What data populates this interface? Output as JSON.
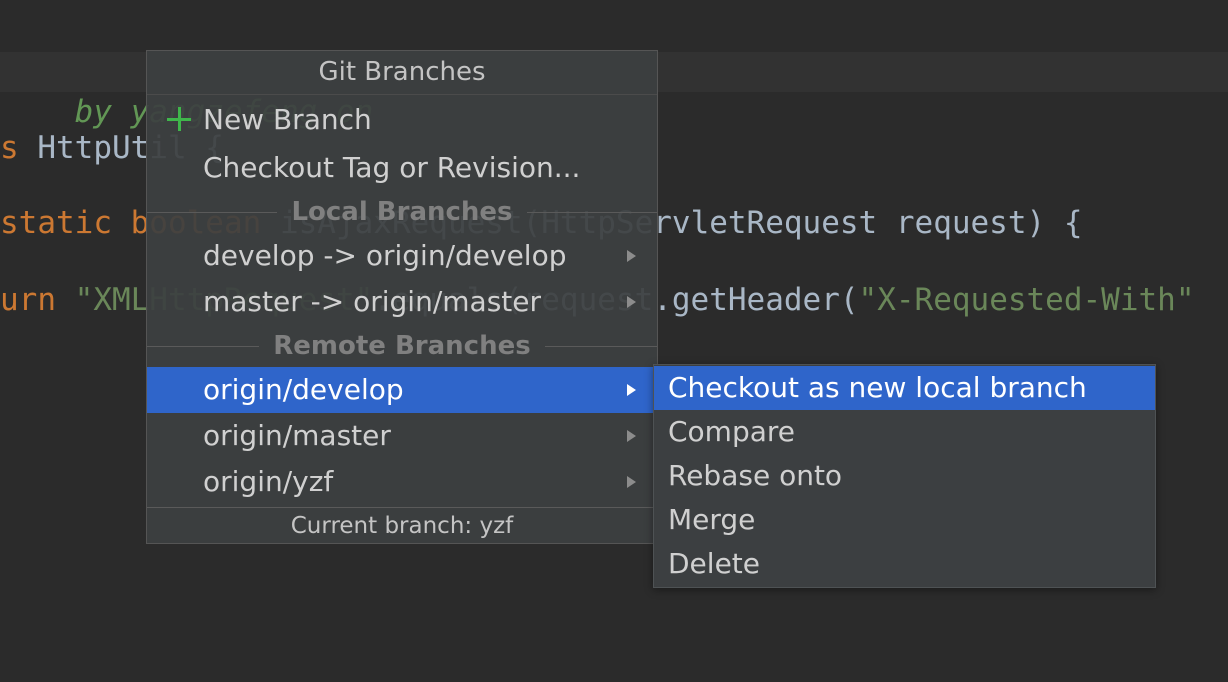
{
  "editor": {
    "line1": "by yangzefeng on",
    "line2_keyword": "s ",
    "line2_text": "HttpUtil {",
    "line3_keyword": "static boolean ",
    "line3_text": "isAjaxRequest(HttpServletRequest request) {",
    "line4_keyword": "urn ",
    "line4_string": "\"XMLHttpRequest\"",
    "line4_text": ".equals(request.getHeader(",
    "line4_string2": "\"X-Requested-With\""
  },
  "popup": {
    "title": "Git Branches",
    "new_branch": "New Branch",
    "checkout_tag": "Checkout Tag or Revision...",
    "local_header": "Local Branches",
    "local_branches": [
      "develop -> origin/develop",
      "master -> origin/master"
    ],
    "remote_header": "Remote Branches",
    "remote_branches": [
      "origin/develop",
      "origin/master",
      "origin/yzf"
    ],
    "footer": "Current branch: yzf"
  },
  "submenu": {
    "items": [
      "Checkout as new local branch",
      "Compare",
      "Rebase onto",
      "Merge",
      "Delete"
    ]
  },
  "icons": {
    "plus": "plus-icon",
    "arrow": "chevron-right-icon"
  },
  "colors": {
    "selection": "#2f65ca",
    "plus_icon": "#3fb64b",
    "editor_bg": "#2b2b2b"
  }
}
